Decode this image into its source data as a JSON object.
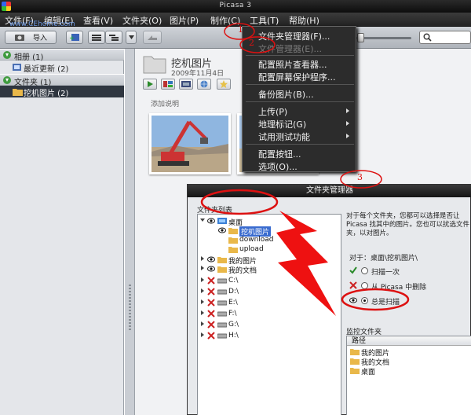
{
  "window": {
    "title": "Picasa 3"
  },
  "watermark": {
    "line1": "www.CEhome.com"
  },
  "menubar": {
    "items": [
      "文件(F)",
      "编辑(E)",
      "查看(V)",
      "文件夹(O)",
      "图片(P)",
      "制作(C)",
      "工具(T)",
      "帮助(H)"
    ]
  },
  "toolbar": {
    "import_label": "导入"
  },
  "library": {
    "albums": {
      "label": "相册 (1)",
      "items": [
        {
          "label": "最近更新 (2)"
        }
      ]
    },
    "folders": {
      "label": "文件夹 (1)",
      "items": [
        {
          "label": "挖机图片 (2)",
          "selected": true
        }
      ]
    }
  },
  "main": {
    "folder_name": "挖机图片",
    "folder_date": "2009年11月4日",
    "caption_hint": "添加说明"
  },
  "tools_menu": {
    "items": [
      {
        "label": "文件夹管理器(F)...",
        "disabled": false,
        "submenu": false
      },
      {
        "label": "文件管理器(E)...",
        "disabled": true,
        "submenu": false
      },
      {
        "label": "配置照片查看器...",
        "disabled": false,
        "submenu": false
      },
      {
        "label": "配置屏幕保护程序...",
        "disabled": false,
        "submenu": false
      },
      {
        "label": "备份图片(B)...",
        "disabled": false,
        "submenu": false
      },
      {
        "label": "上传(P)",
        "disabled": false,
        "submenu": true
      },
      {
        "label": "地理标记(G)",
        "disabled": false,
        "submenu": true
      },
      {
        "label": "试用测试功能",
        "disabled": false,
        "submenu": true
      },
      {
        "label": "配置按钮...",
        "disabled": false,
        "submenu": false
      },
      {
        "label": "选项(O)...",
        "disabled": false,
        "submenu": false
      }
    ]
  },
  "folder_manager": {
    "title": "文件夹管理器",
    "folder_list_label": "文件夹列表",
    "tree": [
      {
        "label": "桌面",
        "status": "eye"
      },
      {
        "label": "挖机图片",
        "status": "eye",
        "selected": true
      },
      {
        "label": "download",
        "status": "none"
      },
      {
        "label": "upload",
        "status": "none"
      },
      {
        "label": "我的图片",
        "status": "eye"
      },
      {
        "label": "我的文档",
        "status": "eye"
      },
      {
        "label": "C:\\",
        "status": "x"
      },
      {
        "label": "D:\\",
        "status": "x"
      },
      {
        "label": "E:\\",
        "status": "x"
      },
      {
        "label": "F:\\",
        "status": "x"
      },
      {
        "label": "G:\\",
        "status": "x"
      },
      {
        "label": "H:\\",
        "status": "x"
      }
    ],
    "description": "对于每个文件夹，您都可以选择是否让 Picasa 找其中的图片。您也可以扰选文件夹，以对图片。",
    "for_label": "对于：桌面\\挖机图片\\",
    "options": [
      {
        "label": "扫描一次",
        "mark": "check",
        "selected": false
      },
      {
        "label": "从 Picasa 中删除",
        "mark": "x",
        "selected": false
      },
      {
        "label": "总是扫描",
        "mark": "eye",
        "selected": true
      }
    ],
    "watched_label": "监控文件夹",
    "watched_header": "路径",
    "watched": [
      "我的图片",
      "我的文档",
      "桌面"
    ]
  },
  "annotations": {
    "n1": "1",
    "n2": "2",
    "n3": "3"
  },
  "colors": {
    "annotation": "#dd1111",
    "selection": "#2f3640",
    "menu_bg": "#2c2c2c"
  }
}
